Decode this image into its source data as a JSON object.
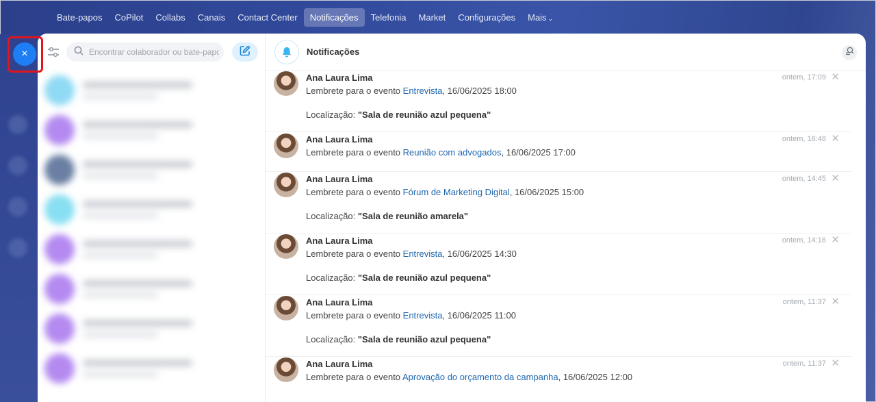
{
  "nav": {
    "items": [
      {
        "label": "Bate-papos"
      },
      {
        "label": "CoPilot"
      },
      {
        "label": "Collabs"
      },
      {
        "label": "Canais"
      },
      {
        "label": "Contact Center"
      },
      {
        "label": "Notificações"
      },
      {
        "label": "Telefonia"
      },
      {
        "label": "Market"
      },
      {
        "label": "Configurações"
      },
      {
        "label": "Mais"
      }
    ],
    "active": "Notificações",
    "more_chevron": "⌄"
  },
  "close_button": {
    "icon": "close-icon",
    "glyph": "×"
  },
  "chat": {
    "search_placeholder": "Encontrar colaborador ou bate-papo"
  },
  "notifications": {
    "title": "Notificações",
    "items": [
      {
        "author": "Ana Laura Lima",
        "prefix": "Lembrete para o evento ",
        "event": "Entrevista",
        "suffix": ", 16/06/2025 18:00",
        "location_label": "Localização: ",
        "location": "\"Sala de reunião azul pequena\"",
        "time": "ontem, 17:09"
      },
      {
        "author": "Ana Laura Lima",
        "prefix": "Lembrete para o evento ",
        "event": "Reunião com advogados",
        "suffix": ", 16/06/2025 17:00",
        "time": "ontem, 16:48"
      },
      {
        "author": "Ana Laura Lima",
        "prefix": "Lembrete para o evento ",
        "event": "Fórum de Marketing Digital",
        "suffix": ", 16/06/2025 15:00",
        "location_label": "Localização: ",
        "location": "\"Sala de reunião amarela\"",
        "time": "ontem, 14:45"
      },
      {
        "author": "Ana Laura Lima",
        "prefix": "Lembrete para o evento ",
        "event": "Entrevista",
        "suffix": ", 16/06/2025 14:30",
        "location_label": "Localização: ",
        "location": "\"Sala de reunião azul pequena\"",
        "time": "ontem, 14:16"
      },
      {
        "author": "Ana Laura Lima",
        "prefix": "Lembrete para o evento ",
        "event": "Entrevista",
        "suffix": ", 16/06/2025 11:00",
        "location_label": "Localização: ",
        "location": "\"Sala de reunião azul pequena\"",
        "time": "ontem, 11:37"
      },
      {
        "author": "Ana Laura Lima",
        "prefix": "Lembrete para o evento ",
        "event": "Aprovação do orçamento da campanha",
        "suffix": ", 16/06/2025 12:00",
        "time": "ontem, 11:37"
      }
    ],
    "dismiss_glyph": "✕"
  },
  "colors": {
    "accent": "#1e7ff5",
    "link": "#2067b0",
    "highlight": "#e2151d"
  }
}
